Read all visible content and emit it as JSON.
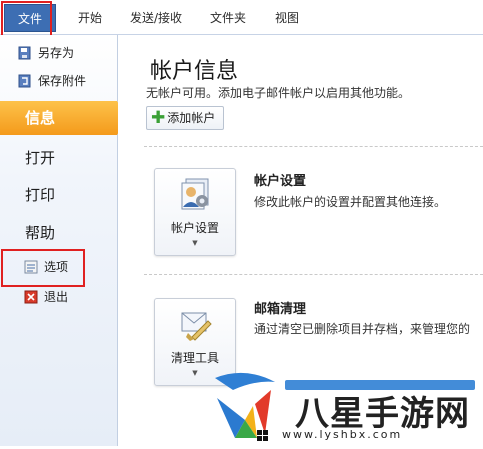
{
  "ribbon": {
    "tabs": [
      "文件",
      "开始",
      "发送/接收",
      "文件夹",
      "视图"
    ]
  },
  "nav": {
    "save_as": "另存为",
    "save_attachments": "保存附件",
    "info": "信息",
    "open": "打开",
    "print": "打印",
    "help": "帮助",
    "options": "选项",
    "exit": "退出"
  },
  "main": {
    "title": "帐户信息",
    "subtitle": "无帐户可用。添加电子邮件帐户以启用其他功能。",
    "add_account": "添加帐户",
    "account_settings": {
      "button_label": "帐户设置",
      "title": "帐户设置",
      "description": "修改此帐户的设置并配置其他连接。"
    },
    "mailbox_cleanup": {
      "button_label": "清理工具",
      "title": "邮箱清理",
      "description": "通过清空已删除项目并存档，来管理您的"
    }
  },
  "watermark": {
    "text": "八星手游网",
    "url": "www.lyshbx.com"
  },
  "colors": {
    "accent_orange": "#f49a1b",
    "file_tab_blue": "#3d6eb3",
    "highlight_red": "#e02020"
  }
}
